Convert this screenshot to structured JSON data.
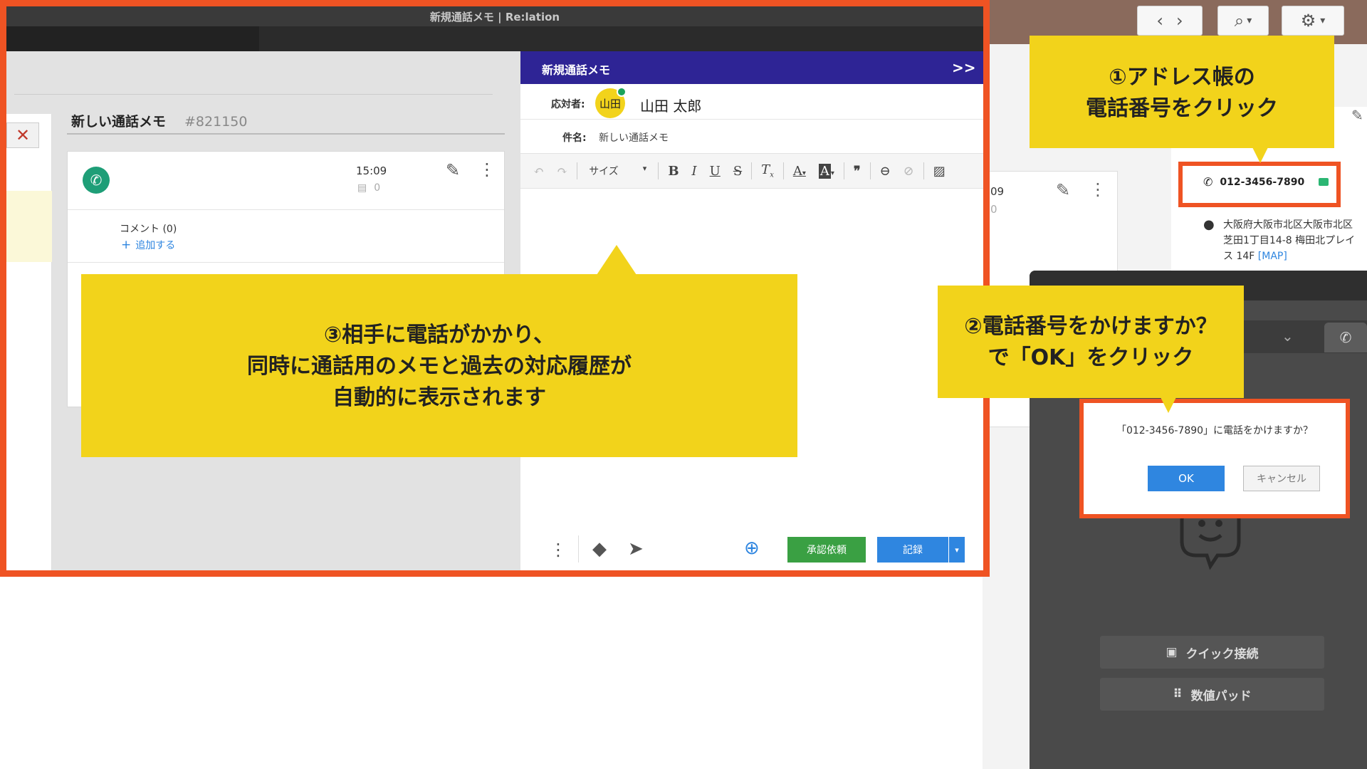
{
  "window": {
    "title": "新規通話メモ | Re:lation"
  },
  "case_view": {
    "title": "新しい通話メモ",
    "ticket_id": "#821150",
    "time": "15:09",
    "comment_count_badge": "0",
    "comment_label": "コメント (0)",
    "add_comment": "追加する"
  },
  "memo": {
    "header_title": "新規通話メモ",
    "collapse_glyph": ">>",
    "responder_label": "応対者:",
    "responder_avatar": "山田",
    "responder_name": "山田 太郎",
    "subject_label": "件名:",
    "subject_value": "新しい通話メモ",
    "font_size_select": "サイズ",
    "approve_button": "承認依頼",
    "save_button": "記録"
  },
  "contact": {
    "phone": "012-3456-7890",
    "address_line1": "大阪府大阪市北区大阪市北区",
    "address_line2": "芝田1丁目14-8 梅田北プレイ",
    "address_line3": "ス 14F",
    "map_link": "[MAP]",
    "partial_time": "09",
    "partial_count": "0"
  },
  "dialog": {
    "message": "「012-3456-7890」に電話をかけますか？",
    "ok": "OK",
    "cancel": "キャンセル"
  },
  "phone_panel": {
    "quick_connect": "クイック接続",
    "numpad": "数値パッド"
  },
  "callouts": {
    "step1_line1": "①アドレス帳の",
    "step1_line2": "電話番号をクリック",
    "step2_line1": "②電話番号をかけますか？",
    "step2_line2": "で「OK」をクリック",
    "step3_line1": "③相手に電話がかかり、",
    "step3_line2": "同時に通話用のメモと過去の対応履歴が",
    "step3_line3": "自動的に表示されます"
  },
  "colors": {
    "highlight_border": "#ef5323",
    "callout_yellow": "#f2d31b",
    "memo_header": "#2e2495",
    "ok_blue": "#2f86e0",
    "approve_green": "#3aa043",
    "phone_green": "#1e9e77"
  }
}
